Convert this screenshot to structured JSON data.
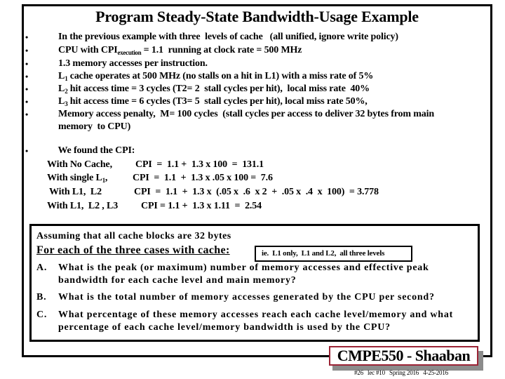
{
  "slide": {
    "title": "Program Steady-State Bandwidth-Usage Example",
    "bullet_glyph": "•",
    "bullets": [
      {
        "pre": "In the previous example with three  levels of cache   (all unified, ignore write policy)",
        "sub": "",
        "post": ""
      },
      {
        "pre": "CPU with CPI",
        "sub": "execution",
        "post": " = 1.1  running at clock rate = 500 MHz"
      },
      {
        "pre": "1.3 memory accesses per instruction.",
        "sub": "",
        "post": ""
      },
      {
        "pre": "L",
        "sub": "1",
        "post": " cache operates at 500 MHz (no stalls on a hit in L1) with a miss rate of 5%"
      },
      {
        "pre": "L",
        "sub": "2",
        "post": " hit access time = 3 cycles (T2= 2  stall cycles per hit),  local miss rate  40%"
      },
      {
        "pre": "L",
        "sub": "3",
        "post": " hit access time = 6 cycles (T3= 5  stall cycles per hit), local miss rate 50%,"
      },
      {
        "pre": "Memory access penalty,  M= 100 cycles  (stall cycles per access to deliver 32 bytes from main",
        "sub": "",
        "post": "",
        "continuation": "memory  to CPU)"
      }
    ],
    "cpi": {
      "heading": "  We found the CPI:",
      "rows": [
        {
          "label_pre": "With No Cache,",
          "label_sub": "",
          "label_post": "",
          "formula": "CPI  =  1.1 +  1.3 x 100  =  131.1"
        },
        {
          "label_pre": "With single L",
          "label_sub": "1",
          "label_post": ",",
          "formula": "CPI  =  1.1  +  1.3 x .05 x 100 =  7.6"
        },
        {
          "label_pre": "With L1,  L2",
          "label_sub": "",
          "label_post": "",
          "formula": "CPI  =  1.1  +  1.3 x  (.05 x  .6  x 2  +  .05 x  .4  x  100)  = 3.778"
        },
        {
          "label_pre": "With L1,  L2 , L3",
          "label_sub": "",
          "label_post": "",
          "formula": "CPI = 1.1 +  1.3 x 1.11  =  2.54"
        }
      ]
    },
    "question_box": {
      "assumption": "Assuming that all cache blocks are 32 bytes",
      "for_each": "For each of the three cases with cache:",
      "hint": "ie.  L1 only,  L1 and L2,  all three levels",
      "questions": [
        {
          "letter": "A.",
          "lines": [
            "What is the peak (or maximum) number of memory accesses and effective peak",
            "bandwidth for each cache level and main memory?"
          ]
        },
        {
          "letter": "B.",
          "lines": [
            "What is the total number of memory accesses generated by the CPU per second?"
          ]
        },
        {
          "letter": "C.",
          "lines": [
            "What percentage of these memory accesses reach each cache level/memory and what",
            "percentage of each cache level/memory bandwidth is used by the CPU?"
          ]
        }
      ]
    },
    "footer": {
      "badge": "CMPE550 - Shaaban",
      "info": "#26   lec #10   Spring 2016   4-25-2016"
    },
    "colors": {
      "frame": "#000000",
      "badge_border": "#9b2335",
      "badge_shadow": "#8c8c8c"
    }
  }
}
